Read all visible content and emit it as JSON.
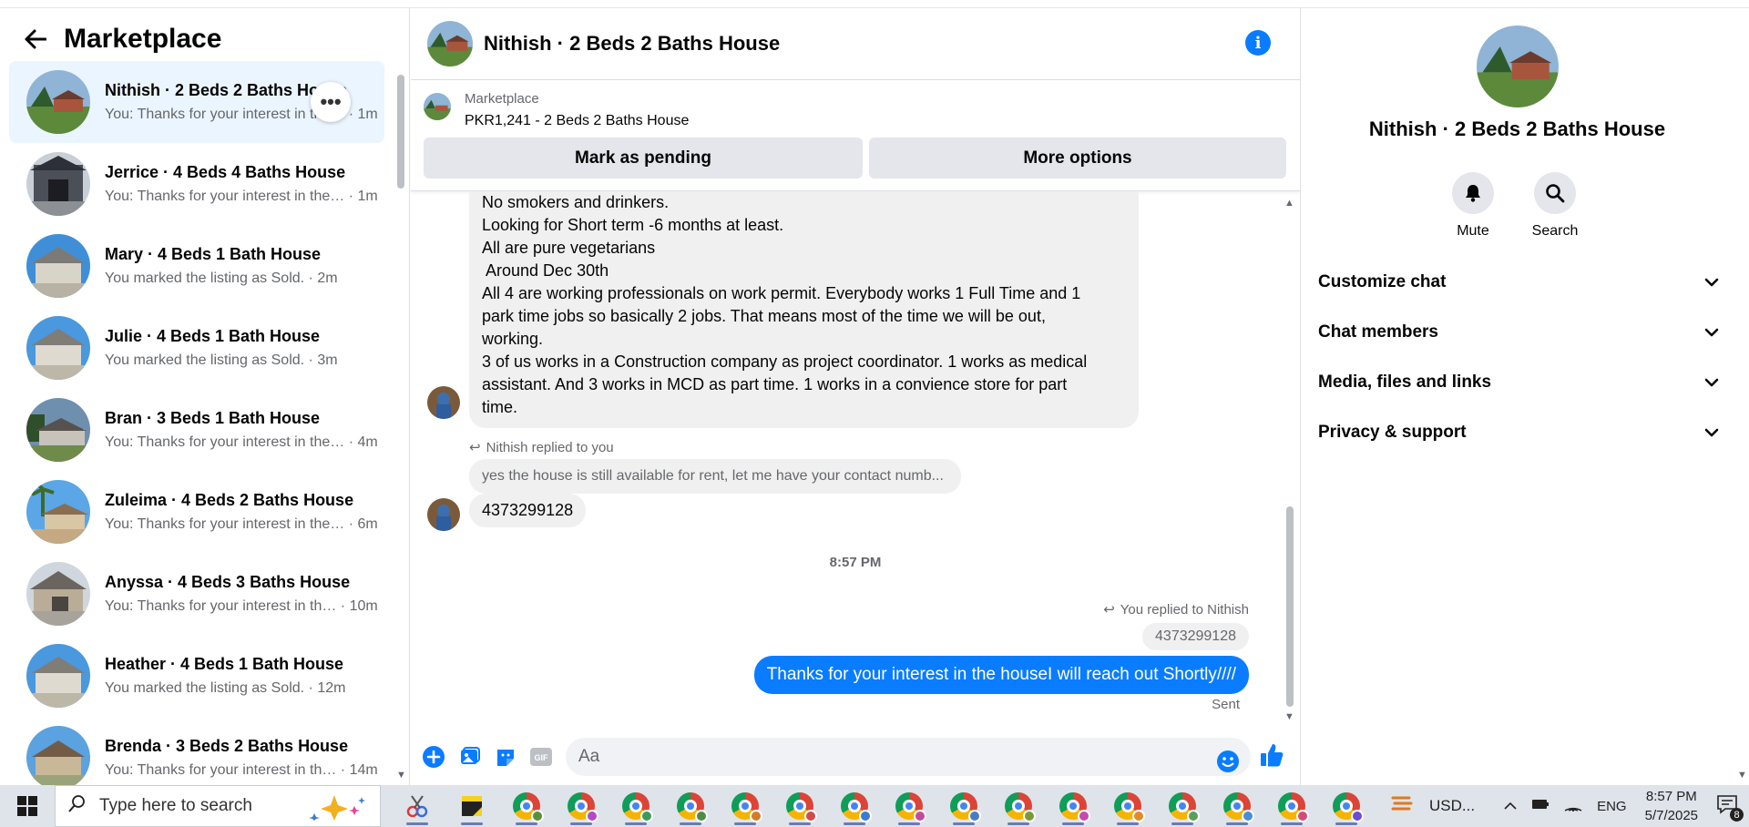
{
  "sidebar": {
    "title": "Marketplace",
    "conversations": [
      {
        "name": "Nithish · 2 Beds 2 Baths House",
        "preview": "You: Thanks for your interest in the… · 1m"
      },
      {
        "name": "Jerrice · 4 Beds 4 Baths House",
        "preview": "You: Thanks for your interest in the… · 1m"
      },
      {
        "name": "Mary · 4 Beds 1 Bath House",
        "preview": "You marked the listing as Sold. · 2m"
      },
      {
        "name": "Julie · 4 Beds 1 Bath House",
        "preview": "You marked the listing as Sold. · 3m"
      },
      {
        "name": "Bran · 3 Beds 1 Bath House",
        "preview": "You: Thanks for your interest in the… · 4m"
      },
      {
        "name": "Zuleima · 4 Beds 2 Baths House",
        "preview": "You: Thanks for your interest in the… · 6m"
      },
      {
        "name": "Anyssa · 4 Beds 3 Baths House",
        "preview": "You: Thanks for your interest in th… · 10m"
      },
      {
        "name": "Heather · 4 Beds 1 Bath House",
        "preview": "You marked the listing as Sold. · 12m"
      },
      {
        "name": "Brenda · 3 Beds 2 Baths House",
        "preview": "You: Thanks for your interest in th… · 14m"
      }
    ]
  },
  "chat": {
    "title": "Nithish · 2 Beds 2 Baths House",
    "marketplace_label": "Marketplace",
    "listing": "PKR1,241 - 2 Beds 2 Baths House",
    "mark_pending": "Mark as pending",
    "more_options": "More options",
    "long_message": [
      "No smokers and drinkers.",
      "Looking for Short term -6 months at least.",
      "All are pure vegetarians",
      " Around Dec 30th",
      "All 4 are working professionals on work permit. Everybody works 1 Full Time and 1",
      "park time jobs so basically 2 jobs. That means most of the time we will be out,",
      "working.",
      "3 of us works in a Construction company as project coordinator. 1 works as medical",
      "assistant. And 3 works in MCD as part time. 1 works in a convience store for part",
      "time."
    ],
    "reply_label_in": "Nithish replied to you",
    "quoted_in": "yes the house is still available for rent, let me have your contact numb...",
    "phone_message": "4373299128",
    "timestamp": "8:57 PM",
    "reply_label_out": "You replied to Nithish",
    "quoted_out": "4373299128",
    "sent_message": "Thanks for your interest in the houseI will reach out Shortly////",
    "sent_status": "Sent",
    "input_placeholder": "Aa"
  },
  "details": {
    "name": "Nithish · 2 Beds 2 Baths House",
    "mute_label": "Mute",
    "search_label": "Search",
    "sections": [
      "Customize chat",
      "Chat members",
      "Media, files and links",
      "Privacy & support"
    ]
  },
  "taskbar": {
    "search_placeholder": "Type here to search",
    "weather": "USD...",
    "language": "ENG",
    "time": "8:57 PM",
    "date": "5/7/2025",
    "notifications": "8"
  },
  "colors": {
    "accent": "#0a7cff",
    "active_row": "#ebf5ff",
    "bubble_in": "#f0f0f0"
  }
}
